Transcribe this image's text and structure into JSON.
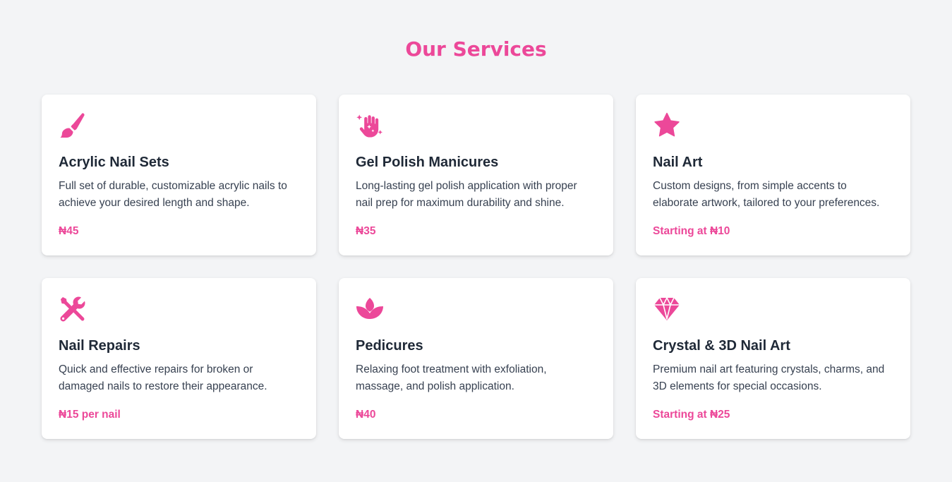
{
  "heading": "Our Services",
  "accent_color": "#ec4899",
  "services": [
    {
      "icon": "paintbrush-icon",
      "title": "Acrylic Nail Sets",
      "description": "Full set of durable, customizable acrylic nails to achieve your desired length and shape.",
      "price": "₦45"
    },
    {
      "icon": "sparkle-hand-icon",
      "title": "Gel Polish Manicures",
      "description": "Long-lasting gel polish application with proper nail prep for maximum durability and shine.",
      "price": "₦35"
    },
    {
      "icon": "star-icon",
      "title": "Nail Art",
      "description": "Custom designs, from simple accents to elaborate artwork, tailored to your preferences.",
      "price": "Starting at ₦10"
    },
    {
      "icon": "tools-icon",
      "title": "Nail Repairs",
      "description": "Quick and effective repairs for broken or damaged nails to restore their appearance.",
      "price": "₦15 per nail"
    },
    {
      "icon": "lotus-icon",
      "title": "Pedicures",
      "description": "Relaxing foot treatment with exfoliation, massage, and polish application.",
      "price": "₦40"
    },
    {
      "icon": "gem-icon",
      "title": "Crystal & 3D Nail Art",
      "description": "Premium nail art featuring crystals, charms, and 3D elements for special occasions.",
      "price": "Starting at ₦25"
    }
  ]
}
